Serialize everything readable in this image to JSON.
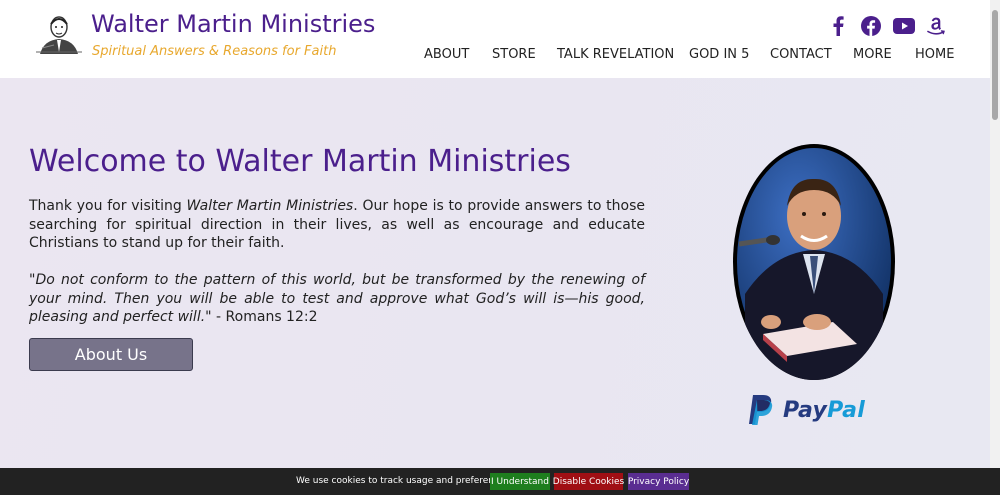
{
  "header": {
    "site_title": "Walter Martin Ministries",
    "tagline": "Spiritual Answers & Reasons for Faith",
    "social": [
      {
        "icon": "facebook-f-icon"
      },
      {
        "icon": "facebook-circle-icon"
      },
      {
        "icon": "youtube-icon"
      },
      {
        "icon": "amazon-icon"
      }
    ],
    "nav": [
      "ABOUT",
      "STORE",
      "TALK REVELATION",
      "GOD IN 5",
      "CONTACT",
      "MORE",
      "HOME"
    ]
  },
  "hero": {
    "title": "Welcome to Walter Martin Ministries",
    "intro_prefix": "Thank you for visiting ",
    "intro_emphasis": "Walter Martin Ministries",
    "intro_suffix": ". Our hope is to provide answers to those searching for spiritual direction in their lives, as well as encourage and educate Christians to stand up for their faith.",
    "quote": "\"Do not conform to the pattern of this world, but be transformed by the renewing of your mind. Then you will be able to test and approve what God’s will is—his good, pleasing and perfect will.\"",
    "quote_ref": " - Romans 12:2",
    "about_button": "About Us"
  },
  "donate": {
    "paypal_pay": "Pay",
    "paypal_pal": "Pal"
  },
  "cookie_bar": {
    "text": "We use cookies to track usage and preferences.",
    "accept": "I Understand",
    "disable": "Disable Cookies",
    "privacy": "Privacy Policy"
  },
  "colors": {
    "brand_purple": "#4b1f8c",
    "tagline_gold": "#e8a82e",
    "button_grey": "#77738a",
    "accept_green": "#1e7e1e",
    "disable_red": "#a00f14",
    "privacy_purple": "#5a2d91"
  }
}
